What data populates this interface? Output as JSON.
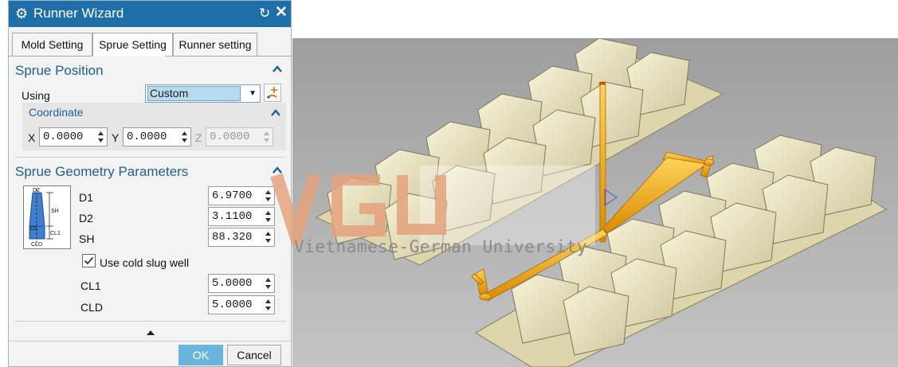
{
  "window": {
    "title": "Runner Wizard"
  },
  "tabs": [
    "Mold Setting",
    "Sprue Setting",
    "Runner setting"
  ],
  "sprue_position": {
    "heading": "Sprue Position",
    "using_label": "Using",
    "using_value": "Custom",
    "coordinate": {
      "heading": "Coordinate",
      "x_label": "X",
      "x_value": "0.0000",
      "y_label": "Y",
      "y_value": "0.0000",
      "z_label": "Z",
      "z_value": "0.0000"
    }
  },
  "sprue_geometry": {
    "heading": "Sprue Geometry Parameters",
    "params": [
      {
        "label": "D1",
        "value": "6.9700"
      },
      {
        "label": "D2",
        "value": "3.1100"
      },
      {
        "label": "SH",
        "value": "88.320"
      }
    ],
    "diagram_labels": {
      "d2": "D2",
      "sh": "SH",
      "d1": "D1",
      "cl1": "CL1",
      "cld": "CLD"
    },
    "use_cold_slug_well_label": "Use cold slug well",
    "use_cold_slug_well_checked": true,
    "cold_slug": [
      {
        "label": "CL1",
        "value": "5.0000"
      },
      {
        "label": "CLD",
        "value": "5.0000"
      }
    ]
  },
  "buttons": {
    "ok": "OK",
    "cancel": "Cancel"
  },
  "watermark": {
    "text": "Vietnamese-German University",
    "logo": "VGU"
  },
  "colors": {
    "titlebar": "#1e6fa8",
    "section_heading": "#1e5f96",
    "ok_button": "#6ab4de",
    "runner": "#f3a312",
    "part": "#ece7c4"
  }
}
